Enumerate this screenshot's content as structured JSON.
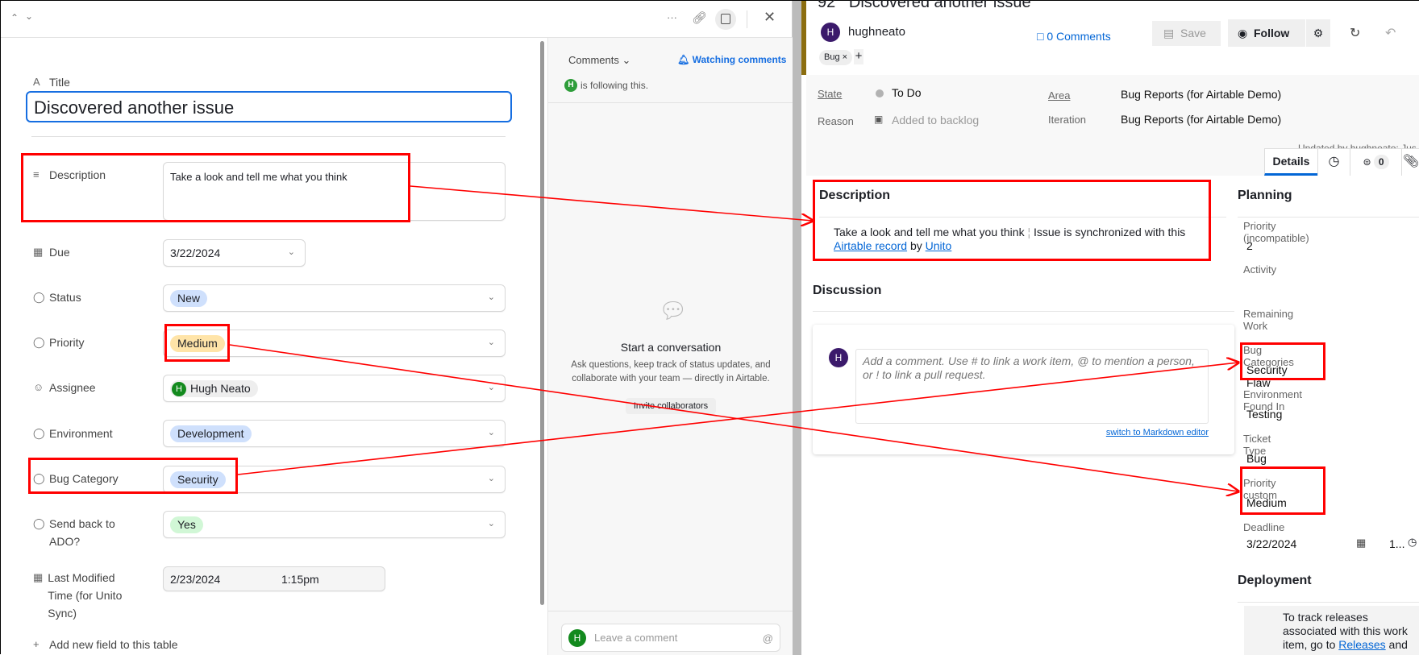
{
  "left": {
    "header_icons": [
      "chevron-up-icon",
      "chevron-down-icon",
      "more-icon",
      "link-icon",
      "comment-icon",
      "close-icon"
    ],
    "title_label": "Title",
    "title_value": "Discovered another issue",
    "fields": {
      "description": {
        "label": "Description",
        "value": "Take a look and tell me what you think"
      },
      "due": {
        "label": "Due",
        "value": "3/22/2024"
      },
      "status": {
        "label": "Status",
        "value": "New"
      },
      "priority": {
        "label": "Priority",
        "value": "Medium"
      },
      "assignee": {
        "label": "Assignee",
        "value": "Hugh Neato",
        "initial": "H"
      },
      "environment": {
        "label": "Environment",
        "value": "Development"
      },
      "bug_category": {
        "label": "Bug Category",
        "value": "Security"
      },
      "send_back": {
        "label": "Send back to ADO?",
        "value": "Yes"
      },
      "last_modified": {
        "label": "Last Modified Time (for Unito Sync)",
        "date": "2/23/2024",
        "time": "1:15pm"
      }
    },
    "add_field": "Add new field to this table",
    "comments": {
      "dropdown": "Comments",
      "watching": "Watching comments",
      "follower_initial": "H",
      "following": "is following this.",
      "empty_title": "Start a conversation",
      "empty_text": "Ask questions, keep track of status updates, and collaborate with your team — directly in Airtable.",
      "invite": "Invite collaborators",
      "input_placeholder": "Leave a comment",
      "input_initial": "H",
      "at": "@"
    }
  },
  "right": {
    "title": "92   Discovered another issue",
    "user": {
      "initial": "H",
      "name": "hughneato"
    },
    "comments_link": "0 Comments",
    "save": "Save",
    "follow": "Follow",
    "tag": "Bug",
    "state": {
      "label": "State",
      "value": "To Do"
    },
    "reason": {
      "label": "Reason",
      "value": "Added to backlog"
    },
    "area": {
      "label": "Area",
      "value": "Bug Reports (for Airtable Demo)"
    },
    "iteration": {
      "label": "Iteration",
      "value": "Bug Reports (for Airtable Demo)"
    },
    "updated": "Updated by hughneato: Jus",
    "tabs": {
      "details": "Details",
      "links_count": "0"
    },
    "description": {
      "heading": "Description",
      "text": "Take a look and tell me what you think",
      "sync_text": "Issue is synchronized with this",
      "link1": "Airtable record",
      "by": "by",
      "link2": "Unito"
    },
    "discussion": {
      "heading": "Discussion",
      "initial": "H",
      "placeholder": "Add a comment. Use # to link a work item, @ to mention a person, or ! to link a pull request.",
      "markdown_link": "switch to Markdown editor"
    },
    "planning": {
      "heading": "Planning",
      "fields": [
        {
          "label": "Priority (incompatible)",
          "value": "2"
        },
        {
          "label": "Activity",
          "value": ""
        },
        {
          "label": "Remaining Work",
          "value": ""
        },
        {
          "label": "Bug Categories",
          "value": "Security Flaw"
        },
        {
          "label": "Environment Found In",
          "value": "Testing"
        },
        {
          "label": "Ticket Type",
          "value": "Bug"
        },
        {
          "label": "Priority custom",
          "value": "Medium"
        }
      ],
      "deadline": {
        "label": "Deadline",
        "date": "3/22/2024",
        "time": "1..."
      }
    },
    "deployment": {
      "heading": "Deployment",
      "text": "To track releases associated with this work item, go to",
      "link": "Releases",
      "tail": "and"
    }
  },
  "colors": {
    "annotation": "#ff0000",
    "accent_blue": "#0366d6",
    "airtable_focus": "#166ee1",
    "avatar_green": "#138a1e",
    "avatar_purple": "#3b1a6b"
  }
}
